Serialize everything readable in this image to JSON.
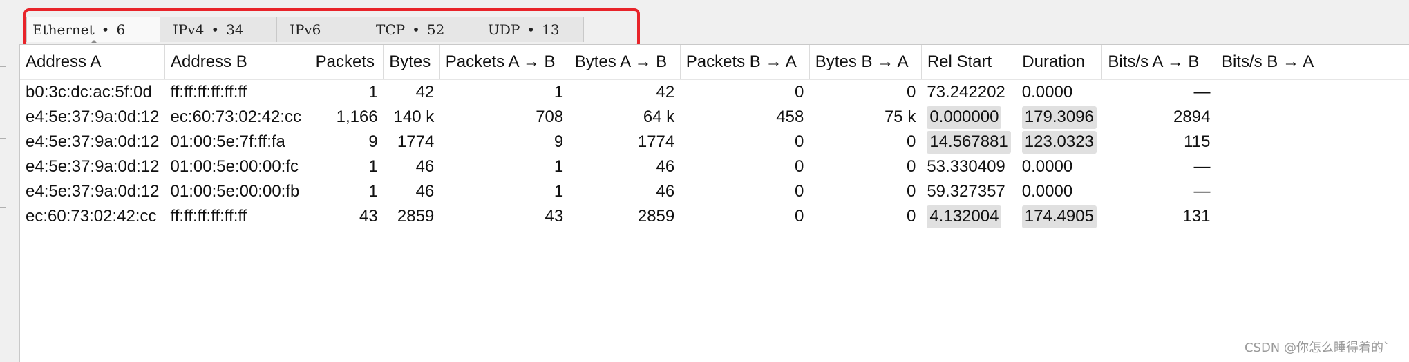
{
  "tabs": [
    {
      "label": "Ethernet",
      "count": "6"
    },
    {
      "label": "IPv4",
      "count": "34"
    },
    {
      "label": "IPv6",
      "count": ""
    },
    {
      "label": "TCP",
      "count": "52"
    },
    {
      "label": "UDP",
      "count": "13"
    }
  ],
  "tab_separator": "•",
  "table": {
    "headers": [
      "Address A",
      "Address B",
      "Packets",
      "Bytes",
      "Packets A → B",
      "Bytes A → B",
      "Packets B → A",
      "Bytes B → A",
      "Rel Start",
      "Duration",
      "Bits/s A → B",
      "Bits/s B → A"
    ],
    "rows": [
      [
        "b0:3c:dc:ac:5f:0d",
        "ff:ff:ff:ff:ff:ff",
        "1",
        "42",
        "1",
        "42",
        "0",
        "0",
        "73.242202",
        "0.0000",
        "—",
        ""
      ],
      [
        "e4:5e:37:9a:0d:12",
        "ec:60:73:02:42:cc",
        "1,166",
        "140 k",
        "708",
        "64 k",
        "458",
        "75 k",
        "0.000000",
        "179.3096",
        "2894",
        ""
      ],
      [
        "e4:5e:37:9a:0d:12",
        "01:00:5e:7f:ff:fa",
        "9",
        "1774",
        "9",
        "1774",
        "0",
        "0",
        "14.567881",
        "123.0323",
        "115",
        ""
      ],
      [
        "e4:5e:37:9a:0d:12",
        "01:00:5e:00:00:fc",
        "1",
        "46",
        "1",
        "46",
        "0",
        "0",
        "53.330409",
        "0.0000",
        "—",
        ""
      ],
      [
        "e4:5e:37:9a:0d:12",
        "01:00:5e:00:00:fb",
        "1",
        "46",
        "1",
        "46",
        "0",
        "0",
        "59.327357",
        "0.0000",
        "—",
        ""
      ],
      [
        "ec:60:73:02:42:cc",
        "ff:ff:ff:ff:ff:ff",
        "43",
        "2859",
        "43",
        "2859",
        "0",
        "0",
        "4.132004",
        "174.4905",
        "131",
        ""
      ]
    ],
    "duration_bar_fraction": [
      0.0,
      1.0,
      0.86,
      0.0,
      0.0,
      1.0
    ]
  },
  "watermark": "CSDN @你怎么睡得着的`",
  "colors": {
    "highlight": "#e8242a",
    "bar_fill": "#e0e0e0"
  }
}
